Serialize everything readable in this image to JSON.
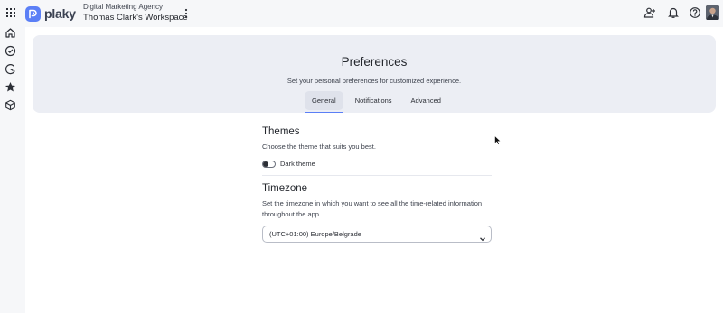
{
  "topbar": {
    "logo_text": "plaky",
    "organization": "Digital Marketing Agency",
    "workspace": "Thomas Clark's Workspace",
    "icons": [
      "apps-grid-icon",
      "more-vertical-icon",
      "add-user-icon",
      "bell-icon",
      "help-icon",
      "avatar"
    ]
  },
  "sidebar": {
    "items": [
      {
        "icon": "home-icon"
      },
      {
        "icon": "check-circle-icon"
      },
      {
        "icon": "chart-clock-icon"
      },
      {
        "icon": "star-icon"
      },
      {
        "icon": "cube-icon"
      }
    ]
  },
  "header": {
    "title": "Preferences",
    "subtitle": "Set your personal preferences for customized experience.",
    "tabs": [
      {
        "label": "General",
        "active": true
      },
      {
        "label": "Notifications",
        "active": false
      },
      {
        "label": "Advanced",
        "active": false
      }
    ]
  },
  "themes": {
    "title": "Themes",
    "description": "Choose the theme that suits you best.",
    "toggle_label": "Dark theme",
    "dark_theme_enabled": false
  },
  "timezone": {
    "title": "Timezone",
    "description_line1": "Set the timezone in which you want to see all the time-related information",
    "description_line2": "throughout the app.",
    "selected": "(UTC+01:00) Europe/Belgrade"
  },
  "colors": {
    "accent": "#5b7ff6",
    "header_card": "#eceef4",
    "background": "#f6f7f9"
  }
}
